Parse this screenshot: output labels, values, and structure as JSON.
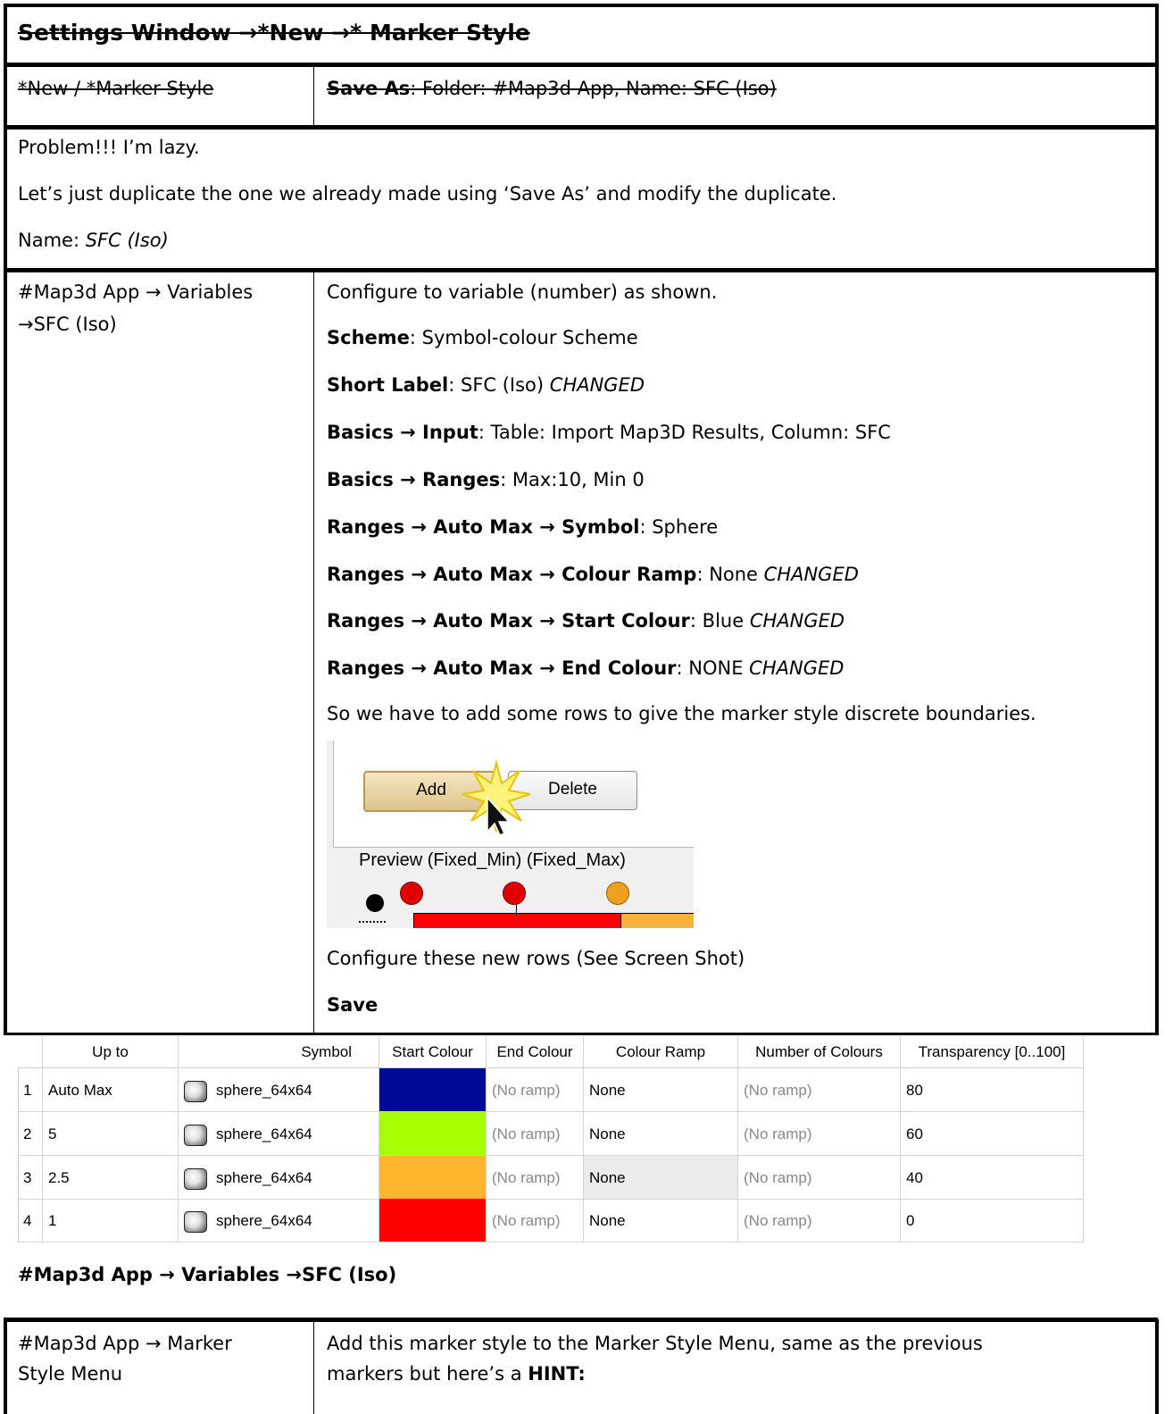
{
  "header": {
    "title": "Settings Window →*New →* Marker Style"
  },
  "row_save_as": {
    "left": "*New / *Marker Style",
    "label": "Save As",
    "value": ": Folder: #Map3d App, Name: SFC (Iso)"
  },
  "intro": {
    "line1": "Problem!!! I’m lazy.",
    "line2": "Let’s just duplicate the one we already made using ‘Save As’ and modify the duplicate.",
    "name_label": "Name: ",
    "name_value": "SFC (Iso)"
  },
  "config": {
    "left_line1": "#Map3d App → Variables",
    "left_line2": "→SFC (Iso)",
    "intro": "Configure to variable (number) as shown.",
    "items": [
      {
        "label": "Scheme",
        "value": ": Symbol-colour Scheme",
        "note": ""
      },
      {
        "label": "Short Label",
        "value": ": SFC (Iso) ",
        "note": "CHANGED"
      },
      {
        "label": "Basics → Input",
        "value": ": Table: Import Map3D Results, Column: SFC",
        "note": ""
      },
      {
        "label": "Basics → Ranges",
        "value": ": Max:10, Min 0",
        "note": ""
      },
      {
        "label": "Ranges → Auto Max → Symbol",
        "value": ": Sphere",
        "note": ""
      },
      {
        "label": "Ranges → Auto Max → Colour Ramp",
        "value": ": None ",
        "note": "CHANGED"
      },
      {
        "label": "Ranges → Auto Max → Start Colour",
        "value": ": Blue ",
        "note": "CHANGED"
      },
      {
        "label": "Ranges → Auto Max → End Colour",
        "value": ": NONE ",
        "note": "CHANGED"
      }
    ],
    "add_rows": "So we have to add some rows to give the marker style discrete boundaries.",
    "configure_rows": "Configure these new rows (See Screen Shot)",
    "save": "Save"
  },
  "screenshot": {
    "add_label": "Add",
    "delete_label": "Delete",
    "preview_label": "Preview (Fixed_Min) (Fixed_Max)"
  },
  "grid": {
    "headers": [
      "Up to",
      "Symbol",
      "Start Colour",
      "End Colour",
      "Colour Ramp",
      "Number of Colours",
      "Transparency [0..100]"
    ],
    "rows": [
      {
        "num": "1",
        "up_to": "Auto Max",
        "symbol": "sphere_64x64",
        "start_colour": "#000a96",
        "end_colour": "(No ramp)",
        "ramp": "None",
        "num_colours": "(No ramp)",
        "transparency": "80"
      },
      {
        "num": "2",
        "up_to": "5",
        "symbol": "sphere_64x64",
        "start_colour": "#a6ff00",
        "end_colour": "(No ramp)",
        "ramp": "None",
        "num_colours": "(No ramp)",
        "transparency": "60"
      },
      {
        "num": "3",
        "up_to": "2.5",
        "symbol": "sphere_64x64",
        "start_colour": "#ffb52e",
        "end_colour": "(No ramp)",
        "ramp": "None",
        "num_colours": "(No ramp)",
        "transparency": "40"
      },
      {
        "num": "4",
        "up_to": "1",
        "symbol": "sphere_64x64",
        "start_colour": "#ff0000",
        "end_colour": "(No ramp)",
        "ramp": "None",
        "num_colours": "(No ramp)",
        "transparency": "0"
      }
    ]
  },
  "caption": "#Map3d App → Variables →SFC (Iso)",
  "footer": {
    "left_line1": "#Map3d App → Marker",
    "left_line2": "Style Menu",
    "right_line1": "Add this marker style to the Marker Style Menu, same as the previous",
    "right_line2_prefix": "markers but here’s a ",
    "right_line2_bold": "HINT:"
  }
}
